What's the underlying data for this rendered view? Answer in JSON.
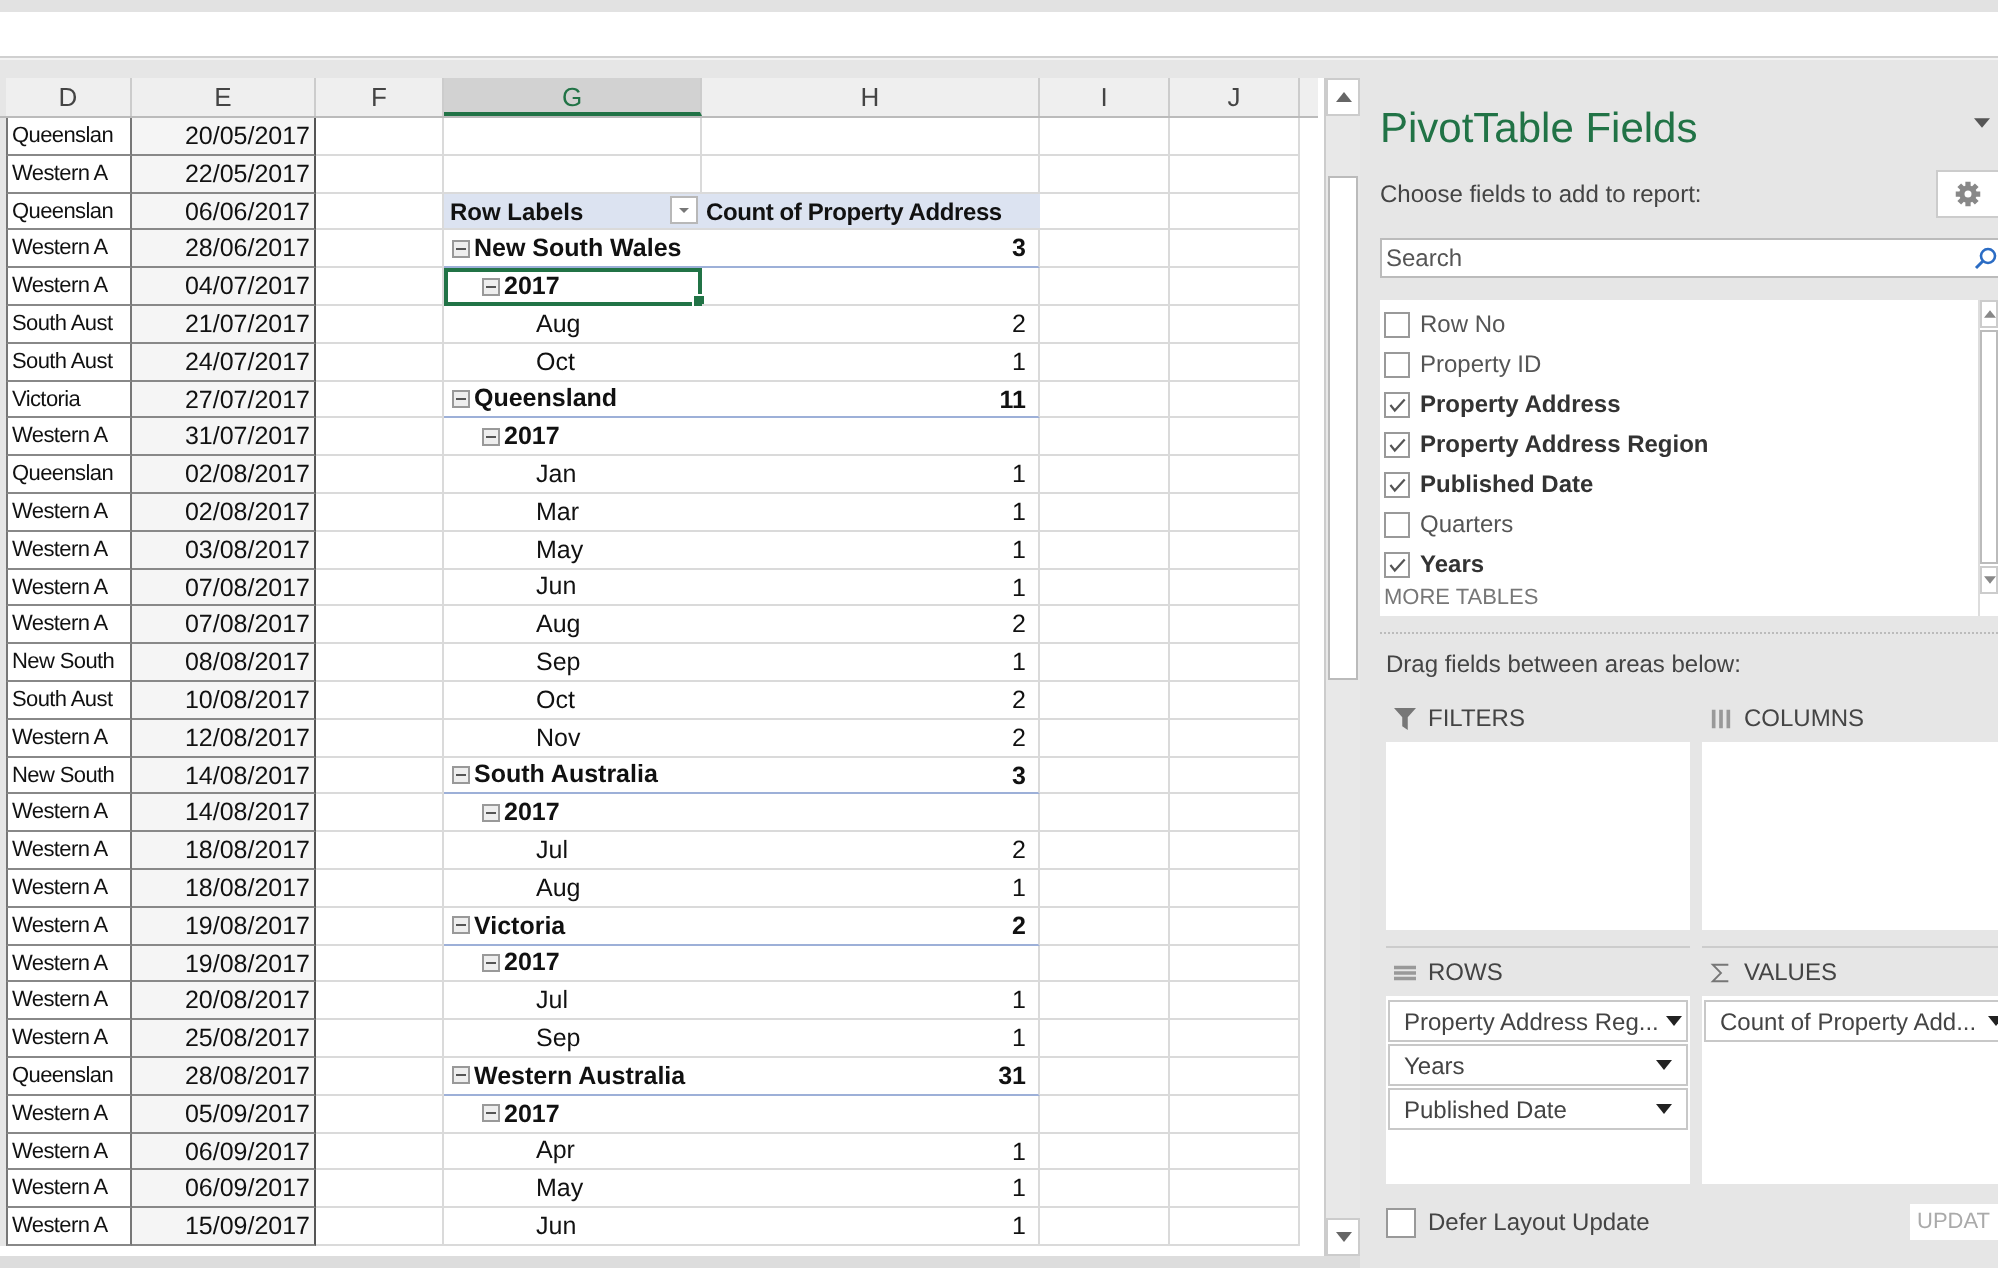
{
  "sheet": {
    "columns": [
      {
        "label": "D",
        "selected": false
      },
      {
        "label": "E",
        "selected": false
      },
      {
        "label": "F",
        "selected": false
      },
      {
        "label": "G",
        "selected": true
      },
      {
        "label": "H",
        "selected": false
      },
      {
        "label": "I",
        "selected": false
      },
      {
        "label": "J",
        "selected": false
      }
    ],
    "rows": [
      {
        "region": "Queenslan",
        "date": "20/05/2017"
      },
      {
        "region": "Western A",
        "date": "22/05/2017"
      },
      {
        "region": "Queenslan",
        "date": "06/06/2017"
      },
      {
        "region": "Western A",
        "date": "28/06/2017"
      },
      {
        "region": "Western A",
        "date": "04/07/2017"
      },
      {
        "region": "South Aust",
        "date": "21/07/2017"
      },
      {
        "region": "South Aust",
        "date": "24/07/2017"
      },
      {
        "region": "Victoria",
        "date": "27/07/2017"
      },
      {
        "region": "Western A",
        "date": "31/07/2017"
      },
      {
        "region": "Queenslan",
        "date": "02/08/2017"
      },
      {
        "region": "Western A",
        "date": "02/08/2017"
      },
      {
        "region": "Western A",
        "date": "03/08/2017"
      },
      {
        "region": "Western A",
        "date": "07/08/2017"
      },
      {
        "region": "Western A",
        "date": "07/08/2017"
      },
      {
        "region": "New South",
        "date": "08/08/2017"
      },
      {
        "region": "South Aust",
        "date": "10/08/2017"
      },
      {
        "region": "Western A",
        "date": "12/08/2017"
      },
      {
        "region": "New South",
        "date": "14/08/2017"
      },
      {
        "region": "Western A",
        "date": "14/08/2017"
      },
      {
        "region": "Western A",
        "date": "18/08/2017"
      },
      {
        "region": "Western A",
        "date": "18/08/2017"
      },
      {
        "region": "Western A",
        "date": "19/08/2017"
      },
      {
        "region": "Western A",
        "date": "19/08/2017"
      },
      {
        "region": "Western A",
        "date": "20/08/2017"
      },
      {
        "region": "Western A",
        "date": "25/08/2017"
      },
      {
        "region": "Queenslan",
        "date": "28/08/2017"
      },
      {
        "region": "Western A",
        "date": "05/09/2017"
      },
      {
        "region": "Western A",
        "date": "06/09/2017"
      },
      {
        "region": "Western A",
        "date": "06/09/2017"
      },
      {
        "region": "Western A",
        "date": "15/09/2017"
      }
    ]
  },
  "pivot": {
    "row_labels": "Row Labels",
    "value_header": "Count of Property Address",
    "regions": [
      {
        "label": "New South Wales",
        "count": "3",
        "expanded": true,
        "selected": false,
        "children": [
          {
            "label": "2017",
            "expanded": true,
            "selected": true,
            "children": [
              {
                "label": "Aug",
                "count": "2",
                "selected": false
              },
              {
                "label": "Oct",
                "count": "1",
                "selected": false
              }
            ]
          }
        ]
      },
      {
        "label": "Queensland",
        "count": "11",
        "expanded": true,
        "selected": false,
        "children": [
          {
            "label": "2017",
            "expanded": true,
            "selected": false,
            "children": [
              {
                "label": "Jan",
                "count": "1",
                "selected": false
              },
              {
                "label": "Mar",
                "count": "1",
                "selected": false
              },
              {
                "label": "May",
                "count": "1",
                "selected": false
              },
              {
                "label": "Jun",
                "count": "1",
                "selected": false
              },
              {
                "label": "Aug",
                "count": "2",
                "selected": false
              },
              {
                "label": "Sep",
                "count": "1",
                "selected": false
              },
              {
                "label": "Oct",
                "count": "2",
                "selected": false
              },
              {
                "label": "Nov",
                "count": "2",
                "selected": false
              }
            ]
          }
        ]
      },
      {
        "label": "South Australia",
        "count": "3",
        "expanded": true,
        "selected": false,
        "children": [
          {
            "label": "2017",
            "expanded": true,
            "selected": false,
            "children": [
              {
                "label": "Jul",
                "count": "2",
                "selected": false
              },
              {
                "label": "Aug",
                "count": "1",
                "selected": false
              }
            ]
          }
        ]
      },
      {
        "label": "Victoria",
        "count": "2",
        "expanded": true,
        "selected": false,
        "children": [
          {
            "label": "2017",
            "expanded": true,
            "selected": false,
            "children": [
              {
                "label": "Jul",
                "count": "1",
                "selected": false
              },
              {
                "label": "Sep",
                "count": "1",
                "selected": false
              }
            ]
          }
        ]
      },
      {
        "label": "Western Australia",
        "count": "31",
        "expanded": true,
        "selected": false,
        "children": [
          {
            "label": "2017",
            "expanded": true,
            "selected": false,
            "children": [
              {
                "label": "Apr",
                "count": "1",
                "selected": false
              },
              {
                "label": "May",
                "count": "1",
                "selected": false
              },
              {
                "label": "Jun",
                "count": "1",
                "selected": false
              }
            ]
          }
        ]
      }
    ]
  },
  "field_pane": {
    "title": "PivotTable Fields",
    "subtitle": "Choose fields to add to report:",
    "search": {
      "placeholder": "Search"
    },
    "fields": [
      {
        "label": "Row No",
        "checked": false
      },
      {
        "label": "Property ID",
        "checked": false
      },
      {
        "label": "Property Address",
        "checked": true
      },
      {
        "label": "Property Address Region",
        "checked": true
      },
      {
        "label": "Published Date",
        "checked": true
      },
      {
        "label": "Quarters",
        "checked": false
      },
      {
        "label": "Years",
        "checked": true
      }
    ],
    "more_tables": "MORE TABLES",
    "drag_hint": "Drag fields between areas below:",
    "areas": [
      {
        "kind": "filters",
        "label": "FILTERS"
      },
      {
        "kind": "columns",
        "label": "COLUMNS"
      },
      {
        "kind": "rows",
        "label": "ROWS",
        "items": [
          "Property Address Reg...",
          "Years",
          "Published Date"
        ]
      },
      {
        "kind": "values",
        "label": "VALUES",
        "items": [
          "Count of Property Add..."
        ]
      }
    ],
    "defer": {
      "label": "Defer Layout Update",
      "checked": false
    },
    "update_button": "UPDAT"
  }
}
